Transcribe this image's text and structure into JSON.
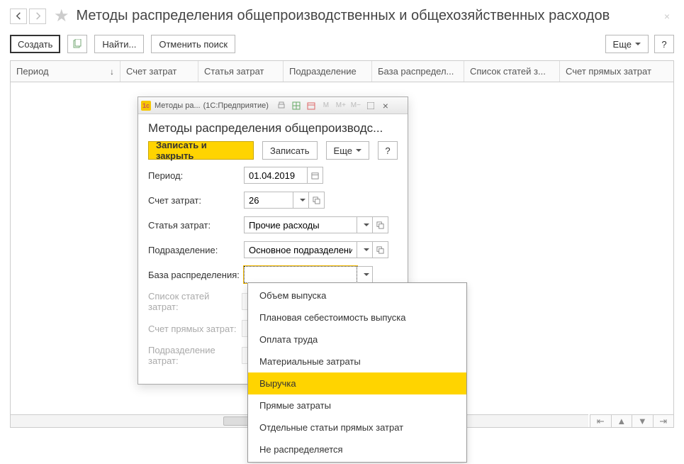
{
  "page": {
    "title": "Методы распределения общепроизводственных и общехозяйственных расходов"
  },
  "toolbar": {
    "create": "Создать",
    "find": "Найти...",
    "cancel_find": "Отменить поиск",
    "more": "Еще",
    "help": "?"
  },
  "columns": {
    "period": "Период",
    "account": "Счет затрат",
    "item": "Статья затрат",
    "dept": "Подразделение",
    "base": "База распредел...",
    "items_list": "Список статей з...",
    "direct_account": "Счет прямых затрат"
  },
  "dialog": {
    "wintitle_left": "Методы ра...",
    "wintitle_right": "(1С:Предприятие)",
    "caption": "Методы распределения общепроизводс...",
    "save_close": "Записать и закрыть",
    "save": "Записать",
    "more": "Еще",
    "help": "?",
    "fields": {
      "period_label": "Период:",
      "period_value": "01.04.2019",
      "account_label": "Счет затрат:",
      "account_value": "26",
      "item_label": "Статья затрат:",
      "item_value": "Прочие расходы",
      "dept_label": "Подразделение:",
      "dept_value": "Основное подразделение",
      "base_label": "База распределения:",
      "base_value": "",
      "items_list_label": "Список статей затрат:",
      "direct_account_label": "Счет прямых затрат:",
      "cost_dept_label": "Подразделение затрат:"
    }
  },
  "dropdown": {
    "items": [
      "Объем выпуска",
      "Плановая себестоимость выпуска",
      "Оплата труда",
      "Материальные затраты",
      "Выручка",
      "Прямые затраты",
      "Отдельные статьи прямых затрат",
      "Не распределяется"
    ],
    "highlighted_index": 4
  }
}
